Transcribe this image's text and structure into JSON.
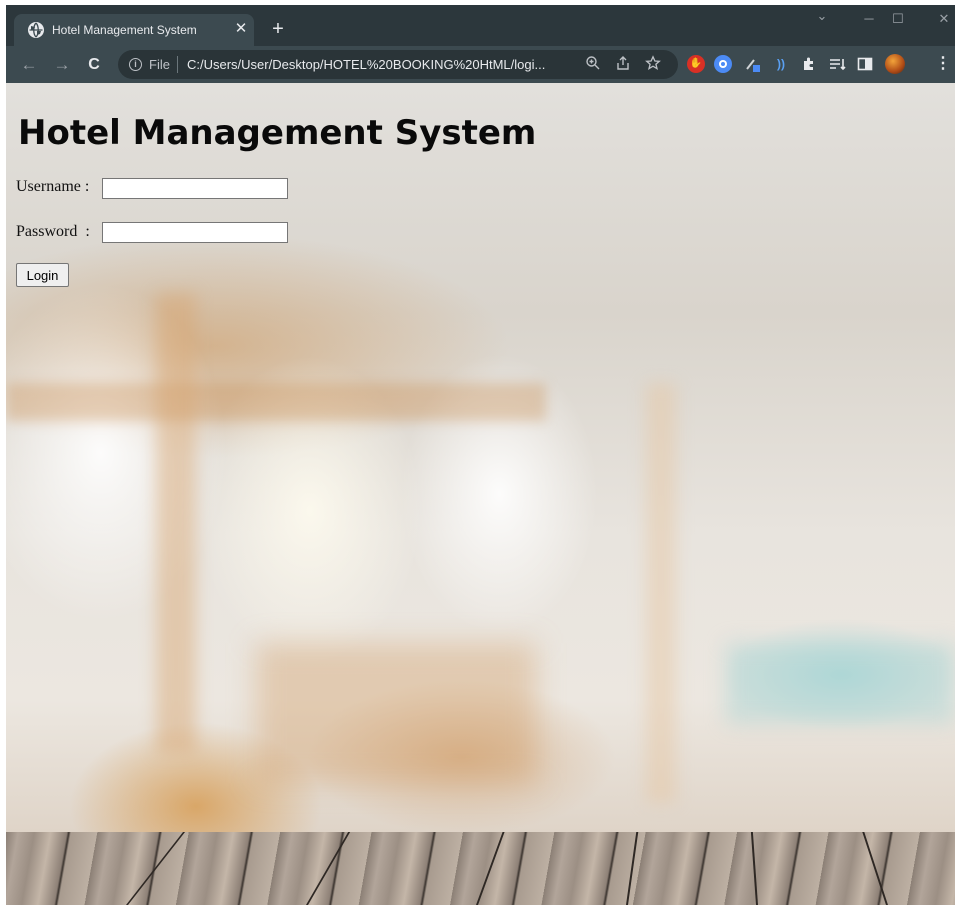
{
  "browser": {
    "tab": {
      "title": "Hotel Management System",
      "close_glyph": "✕",
      "favicon": "globe-icon"
    },
    "new_tab_glyph": "+",
    "window_controls": {
      "minimize": "─",
      "maximize": "☐",
      "close": "✕",
      "dropdown": "⌄"
    },
    "nav": {
      "back": "←",
      "forward": "→",
      "reload": "C"
    },
    "address_bar": {
      "scheme_label": "File",
      "url": "C:/Users/User/Desktop/HOTEL%20BOOKING%20HtML/logi...",
      "info_glyph": "i"
    },
    "omnibox_icons": [
      "zoom-icon",
      "share-icon",
      "bookmark-star-icon"
    ],
    "extensions": [
      "adblock-icon",
      "search-extension-icon",
      "eyedropper-extension-icon",
      "read-aloud-icon",
      "puzzle-extensions-icon",
      "reading-list-icon",
      "side-panel-icon",
      "profile-avatar"
    ],
    "menu_glyph": "⋮"
  },
  "page": {
    "heading": "Hotel Management System",
    "username_label": "Username :",
    "password_label": "Password  :",
    "username_value": "",
    "password_value": "",
    "login_label": "Login"
  },
  "colors": {
    "titlebar": "#2c373c",
    "toolbar": "#3c4a50",
    "omnibox": "#2a3438",
    "heading_text": "#0a0a0a"
  }
}
